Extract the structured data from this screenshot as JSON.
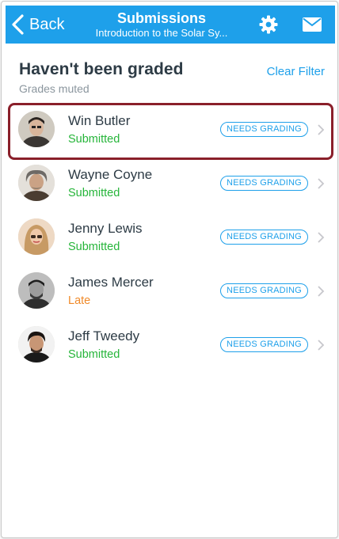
{
  "colors": {
    "brand": "#1ea0ea",
    "submitted": "#26b53a",
    "late": "#f08a2a",
    "highlight": "#8a1f2a"
  },
  "navbar": {
    "back_label": "Back",
    "title": "Submissions",
    "subtitle": "Introduction to the Solar Sy...",
    "settings_icon": "gear-icon",
    "inbox_icon": "mail-icon"
  },
  "header": {
    "title": "Haven't been graded",
    "subtitle": "Grades muted",
    "clear_filter": "Clear Filter"
  },
  "submissions": [
    {
      "name": "Win Butler",
      "status": "Submitted",
      "status_type": "submitted",
      "badge": "NEEDS GRADING"
    },
    {
      "name": "Wayne Coyne",
      "status": "Submitted",
      "status_type": "submitted",
      "badge": "NEEDS GRADING"
    },
    {
      "name": "Jenny Lewis",
      "status": "Submitted",
      "status_type": "submitted",
      "badge": "NEEDS GRADING"
    },
    {
      "name": "James Mercer",
      "status": "Late",
      "status_type": "late",
      "badge": "NEEDS GRADING"
    },
    {
      "name": "Jeff Tweedy",
      "status": "Submitted",
      "status_type": "submitted",
      "badge": "NEEDS GRADING"
    }
  ]
}
